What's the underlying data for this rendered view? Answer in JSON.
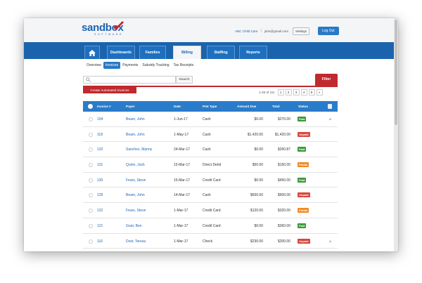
{
  "logo": {
    "brand": "sandbox",
    "sub": "SOFTWARE"
  },
  "header": {
    "center_name": "ABC Child Care",
    "separator": "|",
    "email": "john@gmail.com",
    "settings_label": "Settings",
    "logout_label": "Log Out"
  },
  "nav": {
    "tabs": [
      "Dashboards",
      "Families",
      "Billing",
      "Staffing",
      "Reports"
    ],
    "active": "Billing"
  },
  "subnav": [
    "Overview",
    "Invoices",
    "Payments",
    "Subsidy Tracking",
    "Tax Receipts"
  ],
  "toolbar": {
    "search_placeholder": "",
    "search_label": "Search",
    "filter_label": "Filter",
    "create_label": "Create Automated Invoices"
  },
  "pagination": {
    "info": "1-25 of 111",
    "pages": [
      "1",
      "2",
      "3",
      "4",
      "5",
      "»"
    ]
  },
  "table": {
    "columns": [
      "Invoice #",
      "Payer",
      "Date",
      "Pmt Type",
      "Amount Due",
      "Total",
      "Status"
    ],
    "rows": [
      {
        "invoice": "104",
        "payer": "Beam, John",
        "date": "1-Jun-17",
        "pmt": "Cash",
        "due": "$0.00",
        "total": "$270.00",
        "status": "Paid"
      },
      {
        "invoice": "118",
        "payer": "Beam, John",
        "date": "1-May-17",
        "pmt": "Cash",
        "due": "$1,420.00",
        "total": "$1,420.00",
        "status": "Unpaid"
      },
      {
        "invoice": "132",
        "payer": "Sanchez, Manny",
        "date": "24-Mar-17",
        "pmt": "Cash",
        "due": "$0.00",
        "total": "$260.87",
        "status": "Paid"
      },
      {
        "invoice": "131",
        "payer": "Quinn, Josh",
        "date": "15-Mar-17",
        "pmt": "Direct Debit",
        "due": "$50.00",
        "total": "$150.00",
        "status": "Partial"
      },
      {
        "invoice": "130",
        "payer": "Fears, Steve",
        "date": "15-Mar-17",
        "pmt": "Credit Card",
        "due": "$0.00",
        "total": "$450.00",
        "status": "Paid"
      },
      {
        "invoice": "129",
        "payer": "Beam, John",
        "date": "14-Mar-17",
        "pmt": "Cash",
        "due": "$600.00",
        "total": "$600.00",
        "status": "Unpaid"
      },
      {
        "invoice": "122",
        "payer": "Fears, Steve",
        "date": "1-Mar-17",
        "pmt": "Credit Card",
        "due": "$120.00",
        "total": "$320.00",
        "status": "Partial"
      },
      {
        "invoice": "121",
        "payer": "Goat, Ben",
        "date": "1-Mar-17",
        "pmt": "Credit Card",
        "due": "$0.00",
        "total": "$360.00",
        "status": "Paid"
      },
      {
        "invoice": "116",
        "payer": "Dost, Teresa",
        "date": "1-Mar-17",
        "pmt": "Check",
        "due": "$230.00",
        "total": "$200.00",
        "status": "Unpaid"
      }
    ]
  },
  "colors": {
    "brand_blue": "#1d64b0",
    "nav_blue": "#1b63ad",
    "accent_red": "#c0292e",
    "paid": "#3a9a3a",
    "unpaid": "#d9453d",
    "partial": "#f08a24"
  }
}
